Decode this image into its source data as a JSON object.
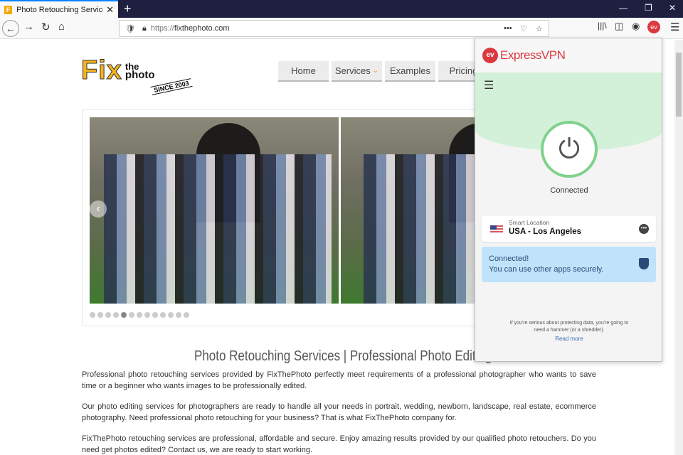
{
  "browser": {
    "tab_title": "Photo Retouching Services | Pro",
    "url_prefix": "https://",
    "url_domain": "fixthephoto.com",
    "new_tab": "+"
  },
  "site": {
    "logo": {
      "fix": "Fix",
      "the": "the",
      "photo": "photo",
      "since": "SINCE 2003"
    },
    "menu": [
      "Home",
      "Services",
      "Examples",
      "Pricing"
    ],
    "carousel": {
      "dots": 13,
      "active_dot": 5
    },
    "title": "Photo Retouching Services | Professional Photo Editing",
    "paragraphs": [
      "Professional photo retouching services provided by FixThePhoto perfectly meet requirements of a professional photographer who wants to save time or a beginner who wants images to be professionally edited.",
      "Our photo editing services for photographers are ready to handle all your needs in portrait, wedding, newborn, landscape, real estate, ecommerce photography.  Need professional photo retouching for your business? That is what FixThePhoto company for.",
      "FixThePhoto retouching services are professional, affordable and secure. Enjoy amazing results provided by our qualified photo retouchers. Do you need get photos edited? Contact us, we are ready to start working."
    ]
  },
  "vpn": {
    "brand": "ExpressVPN",
    "brand_color": "#da3940",
    "status": "Connected",
    "location_label": "Smart Location",
    "location": "USA - Los Angeles",
    "connected_title": "Connected!",
    "connected_msg": "You can use other apps securely.",
    "tip": "If you're serious about protecting data, you're going to need a hammer (or a shredder).",
    "read_more": "Read more"
  }
}
